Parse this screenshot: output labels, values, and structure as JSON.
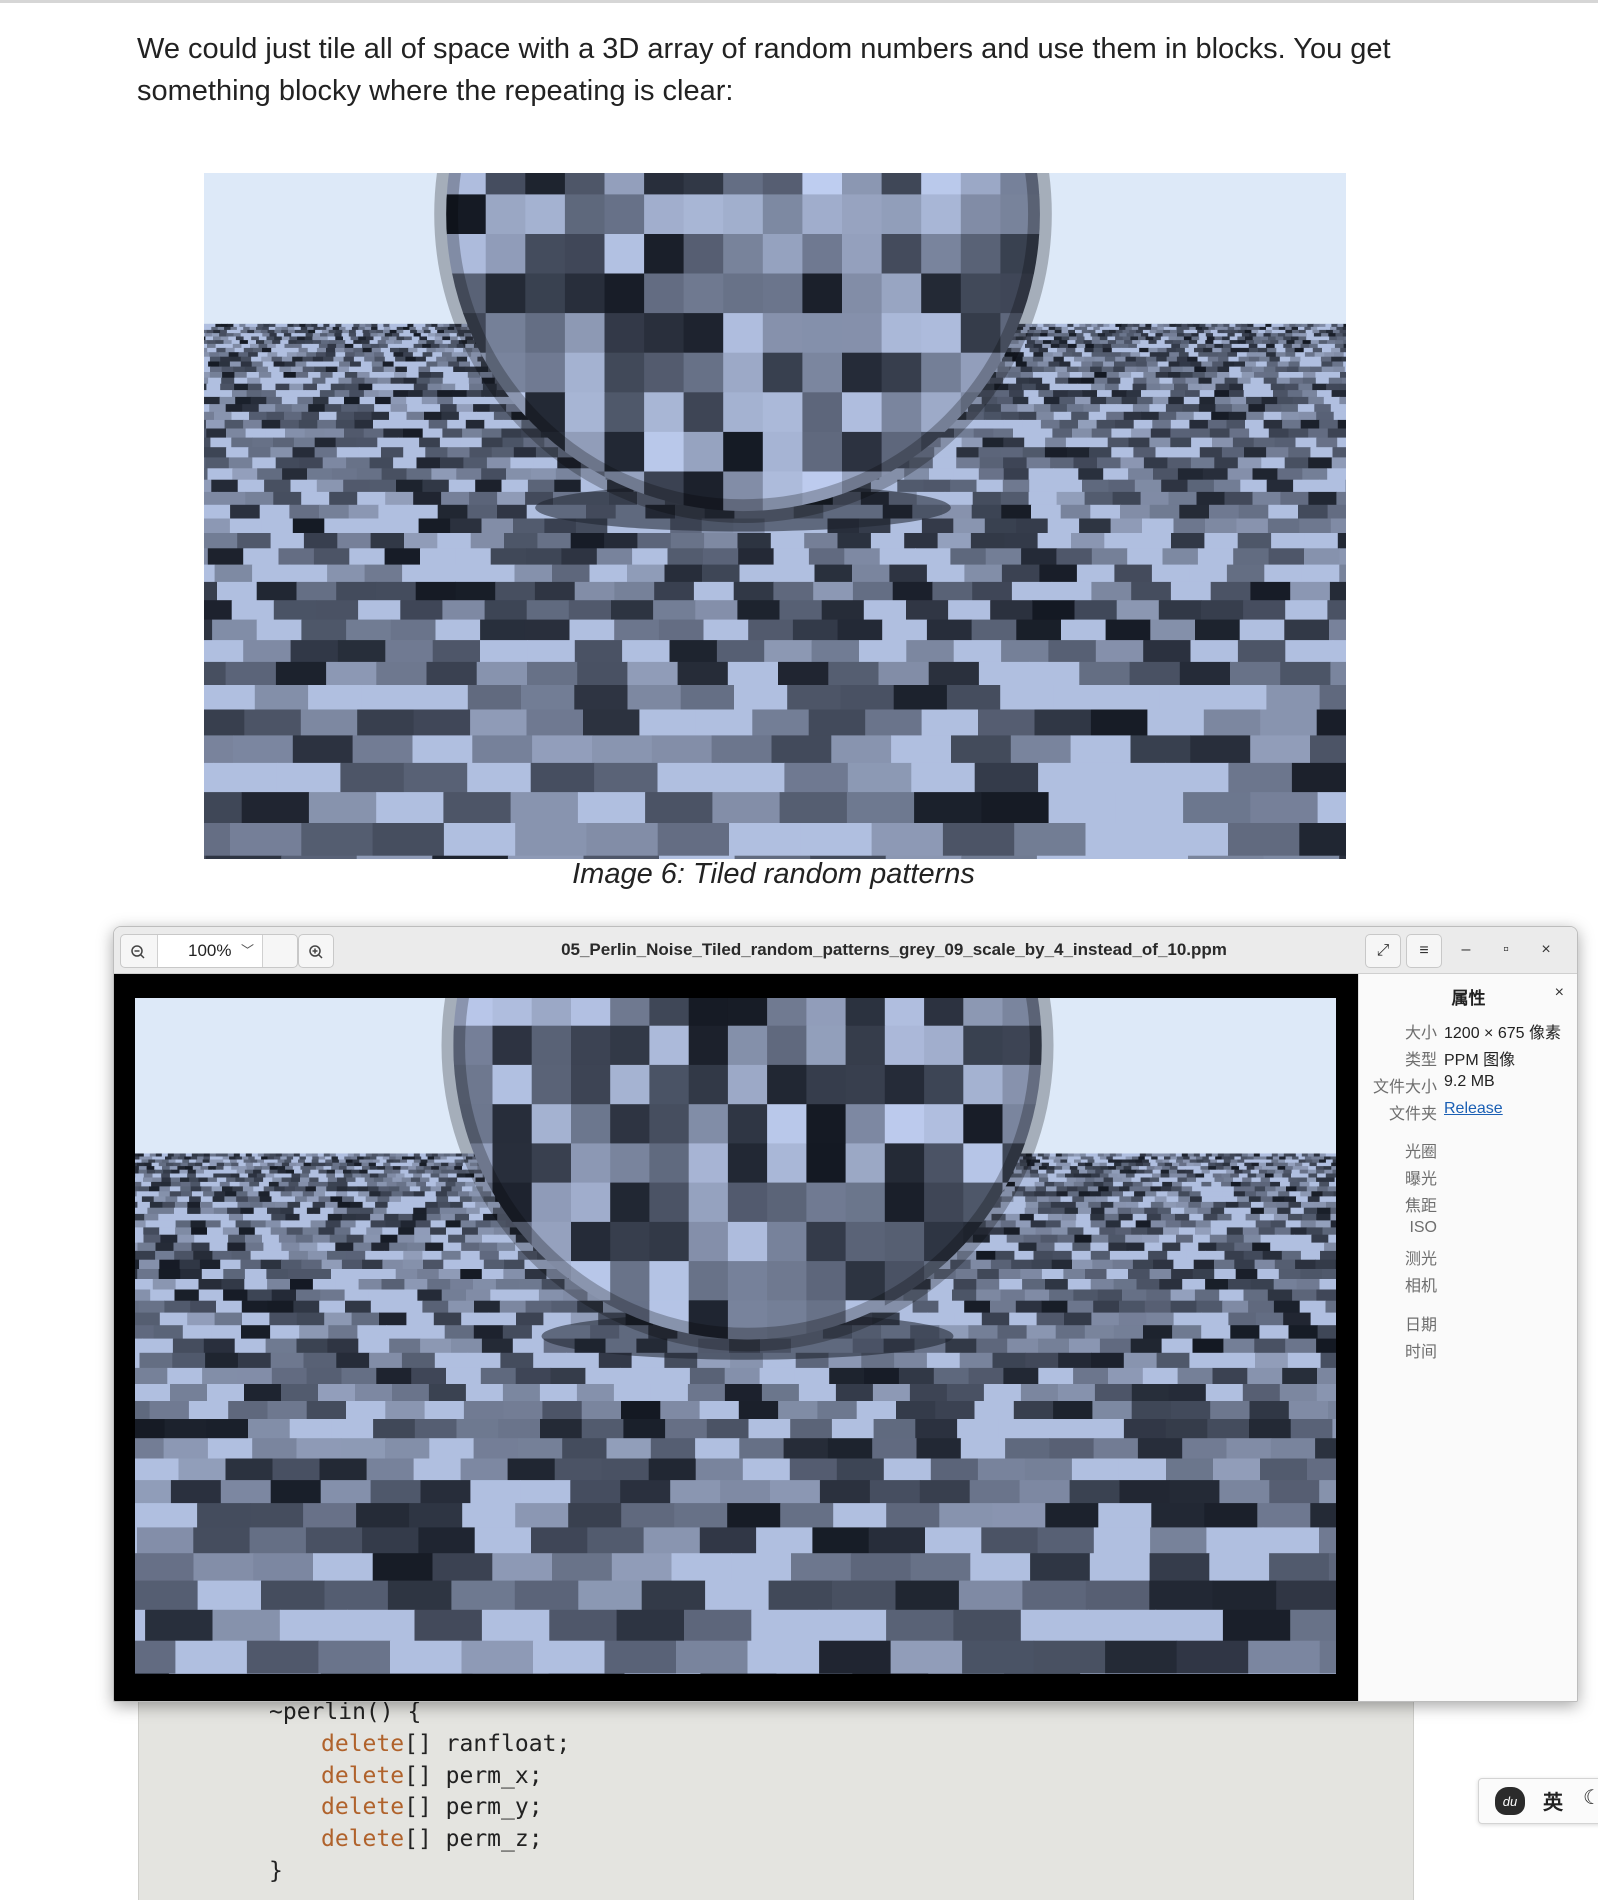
{
  "article": {
    "paragraph": "We could just tile all of space with a 3D array of random numbers and use them in blocks. You get something blocky where the repeating is clear:",
    "caption": "Image 6: Tiled random patterns"
  },
  "viewer": {
    "zoom_value": "100%",
    "zoom_out_icon": "zoom-out-icon",
    "zoom_in_icon": "zoom-in-icon",
    "title": "05_Perlin_Noise_Tiled_random_patterns_grey_09_scale_by_4_instead_of_10.ppm",
    "properties": {
      "heading": "属性",
      "close": "×",
      "rows": [
        {
          "label": "大小",
          "value": "1200 × 675 像素"
        },
        {
          "label": "类型",
          "value": "PPM 图像"
        },
        {
          "label": "文件大小",
          "value": "9.2 MB"
        },
        {
          "label": "文件夹",
          "value": "Release"
        }
      ],
      "exif_labels": [
        "光圈",
        "曝光",
        "焦距",
        "ISO",
        "测光",
        "相机"
      ],
      "date_labels": [
        "日期",
        "时间"
      ]
    },
    "buttons": {
      "fullscreen": "⤢",
      "menu": "≡",
      "minimize": "–",
      "maximize": "▫",
      "close": "×"
    }
  },
  "code": {
    "lines": [
      {
        "kw": "",
        "text": "~perlin() {"
      },
      {
        "kw": "delete",
        "text": "[] ranfloat;"
      },
      {
        "kw": "delete",
        "text": "[] perm_x;"
      },
      {
        "kw": "delete",
        "text": "[] perm_y;"
      },
      {
        "kw": "delete",
        "text": "[] perm_z;"
      },
      {
        "kw": "",
        "text": "}"
      }
    ]
  },
  "ime": {
    "lang": "英",
    "logo": "du"
  },
  "colors": {
    "sky": "#dde9f8",
    "link": "#1a5fb4",
    "keyword": "#b0622b"
  }
}
